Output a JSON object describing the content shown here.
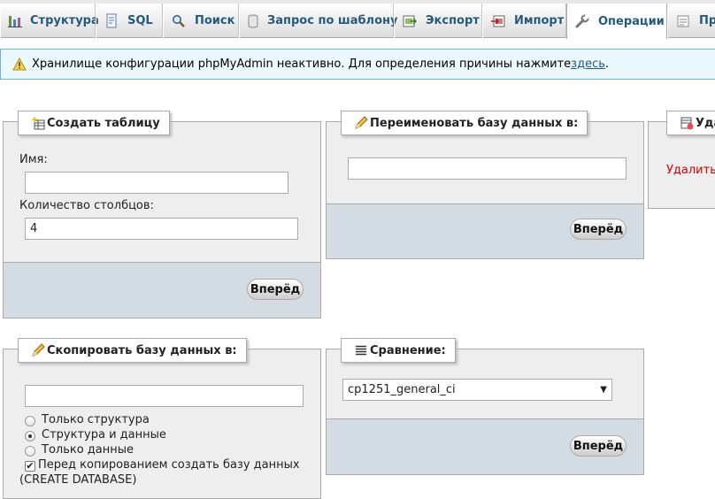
{
  "tabs": [
    {
      "label": "Структура",
      "icon": "structure-icon"
    },
    {
      "label": "SQL",
      "icon": "sql-icon"
    },
    {
      "label": "Поиск",
      "icon": "search-icon"
    },
    {
      "label": "Запрос по шаблону",
      "icon": "query-icon"
    },
    {
      "label": "Экспорт",
      "icon": "export-icon"
    },
    {
      "label": "Импорт",
      "icon": "import-icon"
    },
    {
      "label": "Операции",
      "icon": "wrench-icon",
      "active": true
    },
    {
      "label": "Пр",
      "icon": "privileges-icon"
    }
  ],
  "notice": {
    "text": "Хранилище конфигурации phpMyAdmin неактивно. Для определения причины нажмите ",
    "link": "здесь",
    "suffix": "."
  },
  "create_table": {
    "legend": "Создать таблицу",
    "name_label": "Имя:",
    "name_value": "",
    "columns_label": "Количество столбцов:",
    "columns_value": "4",
    "go": "Вперёд"
  },
  "rename_db": {
    "legend": "Переименовать базу данных в:",
    "value": "",
    "go": "Вперёд"
  },
  "drop_db": {
    "legend": "Уда",
    "link": "Удалить б"
  },
  "copy_db": {
    "legend": "Скопировать базу данных в:",
    "value": "",
    "options": [
      "Только структура",
      "Структура и данные",
      "Только данные"
    ],
    "selected": 1,
    "create_db_check": "Перед копированием создать базу данных",
    "create_db_suffix": "(CREATE DATABASE)"
  },
  "collation": {
    "legend": "Сравнение:",
    "selected": "cp1251_general_ci",
    "go": "Вперёд"
  },
  "colors": {
    "tab_text": "#235a81",
    "panel_bg": "#eeeeee",
    "footer_bg": "#d3dce3",
    "notice_bg": "#ebf8fd",
    "danger": "#d00000"
  }
}
